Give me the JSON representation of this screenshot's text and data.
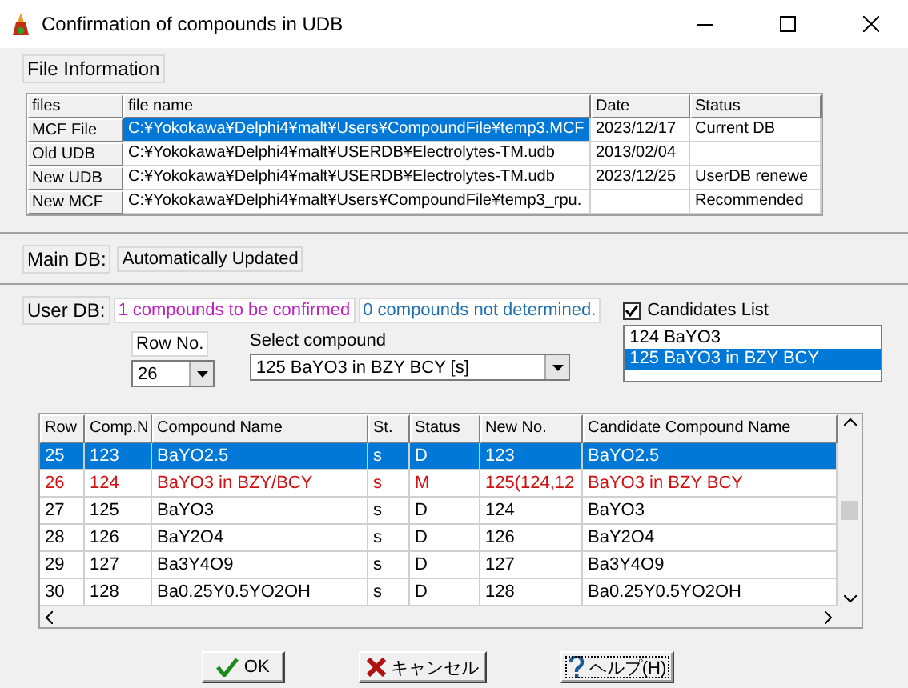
{
  "window": {
    "title": "Confirmation of compounds in UDB"
  },
  "file_info": {
    "label": "File Information",
    "columns": [
      "files",
      "file name",
      "Date",
      "Status"
    ],
    "rows": [
      {
        "cells": [
          "MCF File",
          "C:¥Yokokawa¥Delphi4¥malt¥Users¥CompoundFile¥temp3.MCF",
          "2023/12/17",
          "Current DB"
        ],
        "selected": true
      },
      {
        "cells": [
          "Old UDB",
          "C:¥Yokokawa¥Delphi4¥malt¥USERDB¥Electrolytes-TM.udb",
          "2013/02/04",
          ""
        ],
        "selected": false
      },
      {
        "cells": [
          "New UDB",
          "C:¥Yokokawa¥Delphi4¥malt¥USERDB¥Electrolytes-TM.udb",
          "2023/12/25",
          "UserDB renewe"
        ],
        "selected": false
      },
      {
        "cells": [
          "New MCF",
          "C:¥Yokokawa¥Delphi4¥malt¥Users¥CompoundFile¥temp3_rpu.",
          "",
          "Recommended"
        ],
        "selected": false
      }
    ]
  },
  "main_db": {
    "label": "Main DB:",
    "value": "Automatically Updated"
  },
  "user_db": {
    "label": "User DB:",
    "to_confirm": "1 compounds to be confirmed",
    "not_determined": "0 compounds not determined."
  },
  "candidates": {
    "label": "Candidates List",
    "checked": true,
    "items": [
      {
        "text": "124 BaYO3",
        "selected": false
      },
      {
        "text": "125 BaYO3 in BZY BCY",
        "selected": true
      }
    ]
  },
  "row_no": {
    "label": "Row No.",
    "value": "26"
  },
  "select_compound": {
    "label": "Select compound",
    "value": "125 BaYO3 in BZY BCY [s]"
  },
  "grid": {
    "columns": [
      "Row",
      "Comp.N",
      "Compound Name",
      "St.",
      "Status",
      "New No.",
      "Candidate Compound Name"
    ],
    "rows": [
      {
        "cells": [
          "25",
          "123",
          "BaYO2.5",
          "s",
          "D",
          "123",
          "BaYO2.5"
        ],
        "selected": true,
        "flagged": false
      },
      {
        "cells": [
          "26",
          "124",
          "BaYO3 in BZY/BCY",
          "s",
          "M",
          "125(124,12",
          "BaYO3 in BZY BCY"
        ],
        "selected": false,
        "flagged": true
      },
      {
        "cells": [
          "27",
          "125",
          "BaYO3",
          "s",
          "D",
          "124",
          "BaYO3"
        ],
        "selected": false,
        "flagged": false
      },
      {
        "cells": [
          "28",
          "126",
          "BaY2O4",
          "s",
          "D",
          "126",
          "BaY2O4"
        ],
        "selected": false,
        "flagged": false
      },
      {
        "cells": [
          "29",
          "127",
          "Ba3Y4O9",
          "s",
          "D",
          "127",
          "Ba3Y4O9"
        ],
        "selected": false,
        "flagged": false
      },
      {
        "cells": [
          "30",
          "128",
          "Ba0.25Y0.5YO2OH",
          "s",
          "D",
          "128",
          "Ba0.25Y0.5YO2OH"
        ],
        "selected": false,
        "flagged": false
      }
    ]
  },
  "buttons": [
    {
      "label": "OK",
      "kind": "ok",
      "focused": false
    },
    {
      "label": "キャンセル",
      "kind": "cancel",
      "focused": false
    },
    {
      "label": "ヘルプ(H)",
      "kind": "help",
      "focused": true
    }
  ]
}
